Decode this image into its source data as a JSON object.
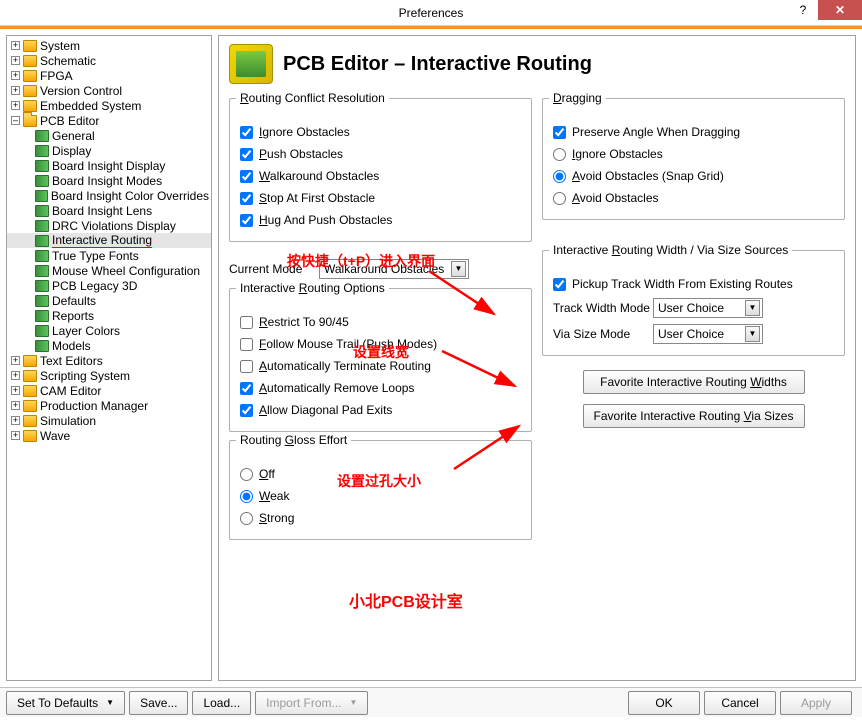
{
  "window": {
    "title": "Preferences",
    "help": "?",
    "close": "✕"
  },
  "tree": {
    "nodes": [
      {
        "lvl": 0,
        "p": "+",
        "t": "folder",
        "lbl": "System"
      },
      {
        "lvl": 0,
        "p": "+",
        "t": "folder",
        "lbl": "Schematic"
      },
      {
        "lvl": 0,
        "p": "+",
        "t": "folder",
        "lbl": "FPGA"
      },
      {
        "lvl": 0,
        "p": "+",
        "t": "folder",
        "lbl": "Version Control"
      },
      {
        "lvl": 0,
        "p": "+",
        "t": "folder",
        "lbl": "Embedded System"
      },
      {
        "lvl": 0,
        "p": "–",
        "t": "folder-open",
        "lbl": "PCB Editor"
      },
      {
        "lvl": 1,
        "p": "",
        "t": "item",
        "lbl": "General"
      },
      {
        "lvl": 1,
        "p": "",
        "t": "item",
        "lbl": "Display"
      },
      {
        "lvl": 1,
        "p": "",
        "t": "item",
        "lbl": "Board Insight Display"
      },
      {
        "lvl": 1,
        "p": "",
        "t": "item",
        "lbl": "Board Insight Modes"
      },
      {
        "lvl": 1,
        "p": "",
        "t": "item",
        "lbl": "Board Insight Color Overrides"
      },
      {
        "lvl": 1,
        "p": "",
        "t": "item",
        "lbl": "Board Insight Lens"
      },
      {
        "lvl": 1,
        "p": "",
        "t": "item",
        "lbl": "DRC Violations Display"
      },
      {
        "lvl": 1,
        "p": "",
        "t": "item",
        "lbl": "Interactive Routing",
        "sel": true
      },
      {
        "lvl": 1,
        "p": "",
        "t": "item",
        "lbl": "True Type Fonts"
      },
      {
        "lvl": 1,
        "p": "",
        "t": "item",
        "lbl": "Mouse Wheel Configuration"
      },
      {
        "lvl": 1,
        "p": "",
        "t": "item",
        "lbl": "PCB Legacy 3D"
      },
      {
        "lvl": 1,
        "p": "",
        "t": "item",
        "lbl": "Defaults"
      },
      {
        "lvl": 1,
        "p": "",
        "t": "item",
        "lbl": "Reports"
      },
      {
        "lvl": 1,
        "p": "",
        "t": "item",
        "lbl": "Layer Colors"
      },
      {
        "lvl": 1,
        "p": "",
        "t": "item",
        "lbl": "Models"
      },
      {
        "lvl": 0,
        "p": "+",
        "t": "folder",
        "lbl": "Text Editors"
      },
      {
        "lvl": 0,
        "p": "+",
        "t": "folder",
        "lbl": "Scripting System"
      },
      {
        "lvl": 0,
        "p": "+",
        "t": "folder",
        "lbl": "CAM Editor"
      },
      {
        "lvl": 0,
        "p": "+",
        "t": "folder",
        "lbl": "Production Manager"
      },
      {
        "lvl": 0,
        "p": "+",
        "t": "folder",
        "lbl": "Simulation"
      },
      {
        "lvl": 0,
        "p": "+",
        "t": "folder",
        "lbl": "Wave"
      }
    ]
  },
  "header": {
    "title": "PCB Editor – Interactive Routing"
  },
  "groups": {
    "conflict": {
      "title": "Routing Conflict Resolution",
      "items": [
        {
          "lbl": "Ignore Obstacles",
          "c": true
        },
        {
          "lbl": "Push Obstacles",
          "c": true
        },
        {
          "lbl": "Walkaround Obstacles",
          "c": true
        },
        {
          "lbl": "Stop At First Obstacle",
          "c": true
        },
        {
          "lbl": "Hug And Push Obstacles",
          "c": true
        }
      ]
    },
    "dragging": {
      "title": "Dragging",
      "preserve": {
        "lbl": "Preserve Angle When Dragging",
        "c": true
      },
      "radios": [
        {
          "lbl": "Ignore Obstacles",
          "c": false
        },
        {
          "lbl": "Avoid Obstacles (Snap Grid)",
          "c": true
        },
        {
          "lbl": "Avoid Obstacles",
          "c": false
        }
      ]
    },
    "sources": {
      "title": "Interactive Routing Width / Via Size Sources",
      "pickup": {
        "lbl": "Pickup Track Width From Existing Routes",
        "c": true
      },
      "track": {
        "lbl": "Track Width Mode",
        "val": "User Choice"
      },
      "via": {
        "lbl": "Via Size Mode",
        "val": "User Choice"
      }
    },
    "currentMode": {
      "lbl": "Current Mode",
      "val": "Walkaround Obstacles"
    },
    "options": {
      "title": "Interactive Routing Options",
      "items": [
        {
          "lbl": "Restrict To 90/45",
          "c": false
        },
        {
          "lbl": "Follow Mouse Trail (Push Modes)",
          "c": false
        },
        {
          "lbl": "Automatically Terminate Routing",
          "c": false
        },
        {
          "lbl": "Automatically Remove Loops",
          "c": true
        },
        {
          "lbl": "Allow Diagonal Pad Exits",
          "c": true
        }
      ]
    },
    "gloss": {
      "title": "Routing Gloss Effort",
      "radios": [
        {
          "lbl": "Off",
          "c": false
        },
        {
          "lbl": "Weak",
          "c": true
        },
        {
          "lbl": "Strong",
          "c": false
        }
      ]
    },
    "buttons": {
      "widths": "Favorite Interactive Routing Widths",
      "vias": "Favorite Interactive Routing Via Sizes"
    }
  },
  "annotations": {
    "a1": "按快捷（t+P）进入界面",
    "a2": "设置线宽",
    "a3": "设置过孔大小",
    "a4": "小北PCB设计室"
  },
  "bottom": {
    "defaults": "Set To Defaults",
    "save": "Save...",
    "load": "Load...",
    "import": "Import From...",
    "ok": "OK",
    "cancel": "Cancel",
    "apply": "Apply"
  }
}
